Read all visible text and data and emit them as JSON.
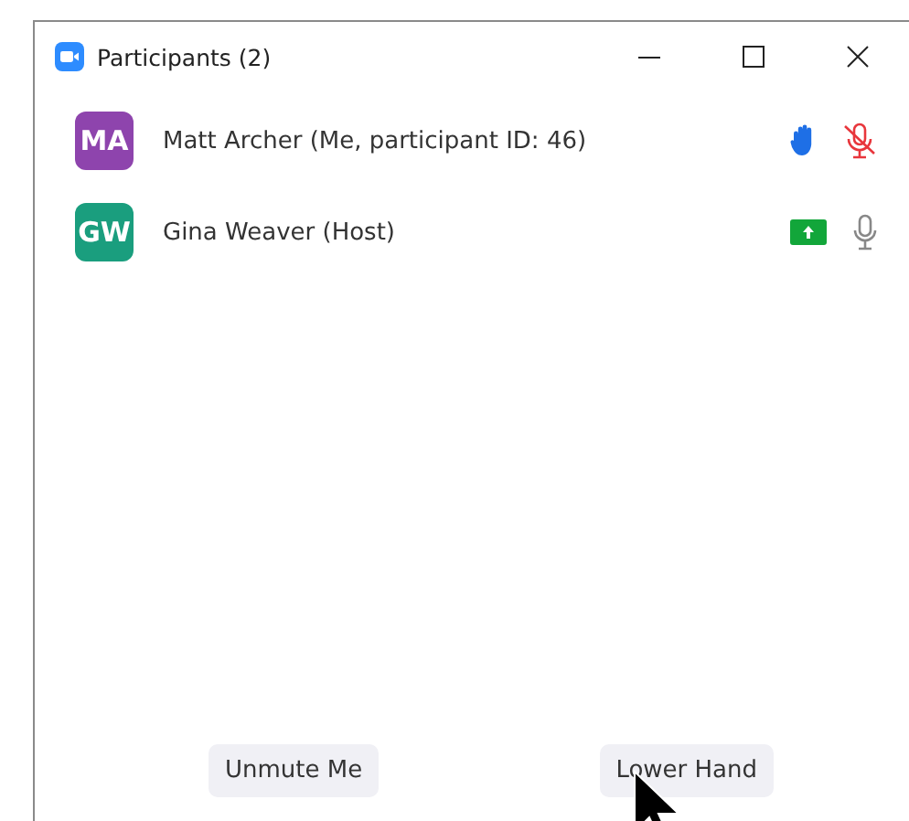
{
  "window": {
    "title": "Participants (2)"
  },
  "participants": [
    {
      "initials": "MA",
      "name": "Matt Archer (Me, participant ID: 46)",
      "color": "#8e44ad",
      "hand_raised": true,
      "sharing": false,
      "muted": true
    },
    {
      "initials": "GW",
      "name": "Gina Weaver (Host)",
      "color": "#1a9e7e",
      "hand_raised": false,
      "sharing": true,
      "muted": false
    }
  ],
  "buttons": [
    "Unmute Me",
    "Lower Hand"
  ]
}
